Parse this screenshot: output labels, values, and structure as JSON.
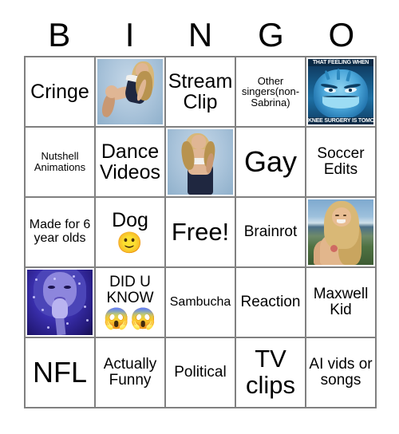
{
  "header": {
    "letters": [
      "B",
      "I",
      "N",
      "G",
      "O"
    ]
  },
  "grid": {
    "rows": [
      [
        {
          "kind": "text",
          "text": "Cringe",
          "size": "fs-l"
        },
        {
          "kind": "image",
          "image": "blonde-in-navy-dress-studio-photo",
          "alt": "Blonde woman seated in navy and white strapless dress on light blue background"
        },
        {
          "kind": "text",
          "text": "Stream Clip",
          "size": "fs-l"
        },
        {
          "kind": "text",
          "text": "Other singers(non-Sabrina)",
          "size": "fs-xs"
        },
        {
          "kind": "image",
          "image": "grinch-that-feeling-when-meme",
          "alt": "Blue Grinch meme",
          "meme_top": "THAT FEELING WHEN",
          "meme_bottom": "KNEE SURGERY IS TOMORROW"
        }
      ],
      [
        {
          "kind": "text",
          "text": "Nutshell Animations",
          "size": "fs-xs"
        },
        {
          "kind": "text",
          "text": "Dance Videos",
          "size": "fs-l"
        },
        {
          "kind": "image",
          "image": "blonde-standing-navy-dress-photo",
          "alt": "Blonde woman standing in navy and white dress on light blue background"
        },
        {
          "kind": "text",
          "text": "Gay",
          "size": "fs-xxl"
        },
        {
          "kind": "text",
          "text": "Soccer Edits",
          "size": "fs-m"
        }
      ],
      [
        {
          "kind": "text",
          "text": "Made for 6 year olds",
          "size": "fs-s"
        },
        {
          "kind": "text",
          "text": "Dog",
          "size": "fs-l",
          "emoji": "🙂"
        },
        {
          "kind": "text",
          "text": "Free!",
          "size": "fs-xl"
        },
        {
          "kind": "text",
          "text": "Brainrot",
          "size": "fs-m"
        },
        {
          "kind": "image",
          "image": "blonde-outdoors-ocean-hills-photo",
          "alt": "Smiling blonde woman outdoors with ocean and green hills behind"
        }
      ],
      [
        {
          "kind": "image",
          "image": "singer-blue-stage-light-microphone-photo",
          "alt": "Singer lit in blue and purple stage light holding a microphone"
        },
        {
          "kind": "text",
          "text": "DID U KNOW",
          "size": "fs-m",
          "emoji": "😱😱"
        },
        {
          "kind": "text",
          "text": "Sambucha",
          "size": "fs-s"
        },
        {
          "kind": "text",
          "text": "Reaction",
          "size": "fs-m"
        },
        {
          "kind": "text",
          "text": "Maxwell Kid",
          "size": "fs-m"
        }
      ],
      [
        {
          "kind": "text",
          "text": "NFL",
          "size": "fs-xxl"
        },
        {
          "kind": "text",
          "text": "Actually Funny",
          "size": "fs-m"
        },
        {
          "kind": "text",
          "text": "Political",
          "size": "fs-m"
        },
        {
          "kind": "text",
          "text": "TV clips",
          "size": "fs-xl"
        },
        {
          "kind": "text",
          "text": "AI vids or songs",
          "size": "fs-m"
        }
      ]
    ]
  },
  "colors": {
    "grid_line": "#808080",
    "background": "#ffffff",
    "text": "#000000"
  }
}
